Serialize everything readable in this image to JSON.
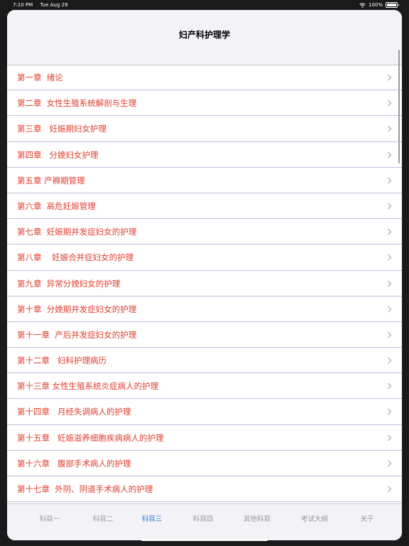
{
  "status": {
    "time": "7:10 PM",
    "date": "Tue Aug 29",
    "battery": "100%"
  },
  "header": {
    "title": "妇产科护理学"
  },
  "chapters": [
    "第一章  绪论",
    "第二章  女性生殖系统解剖与生理",
    "第三章   妊娠期妇女护理",
    "第四章   分娩妇女护理",
    "第五章 产褥期管理",
    "第六章  高危妊娠管理",
    "第七章  妊娠期并发症妇女的护理",
    "第八章    妊娠合并症妇女的护理",
    "第九章  异常分娩妇女的护理",
    "第十章  分娩期并发症妇女的护理",
    "第十一章  产后并发症妇女的护理",
    "第十二章   妇科护理病历",
    "第十三章 女性生殖系统炎症病人的护理",
    "第十四章   月经失调病人的护理",
    "第十五章   妊娠滋养细胞疾病病人的护理",
    "第十六章   腹部手术病人的护理",
    "第十七章  外阴、阴道手术病人的护理"
  ],
  "tabs": [
    {
      "label": "科目一",
      "active": false
    },
    {
      "label": "科目二",
      "active": false
    },
    {
      "label": "科目三",
      "active": true
    },
    {
      "label": "科目四",
      "active": false
    },
    {
      "label": "其他科目",
      "active": false
    },
    {
      "label": "考试大纲",
      "active": false
    },
    {
      "label": "关于",
      "active": false
    }
  ],
  "colors": {
    "accent": "#2a7de1",
    "item_text": "#e0402f",
    "tab_inactive": "#9b9b9b"
  }
}
